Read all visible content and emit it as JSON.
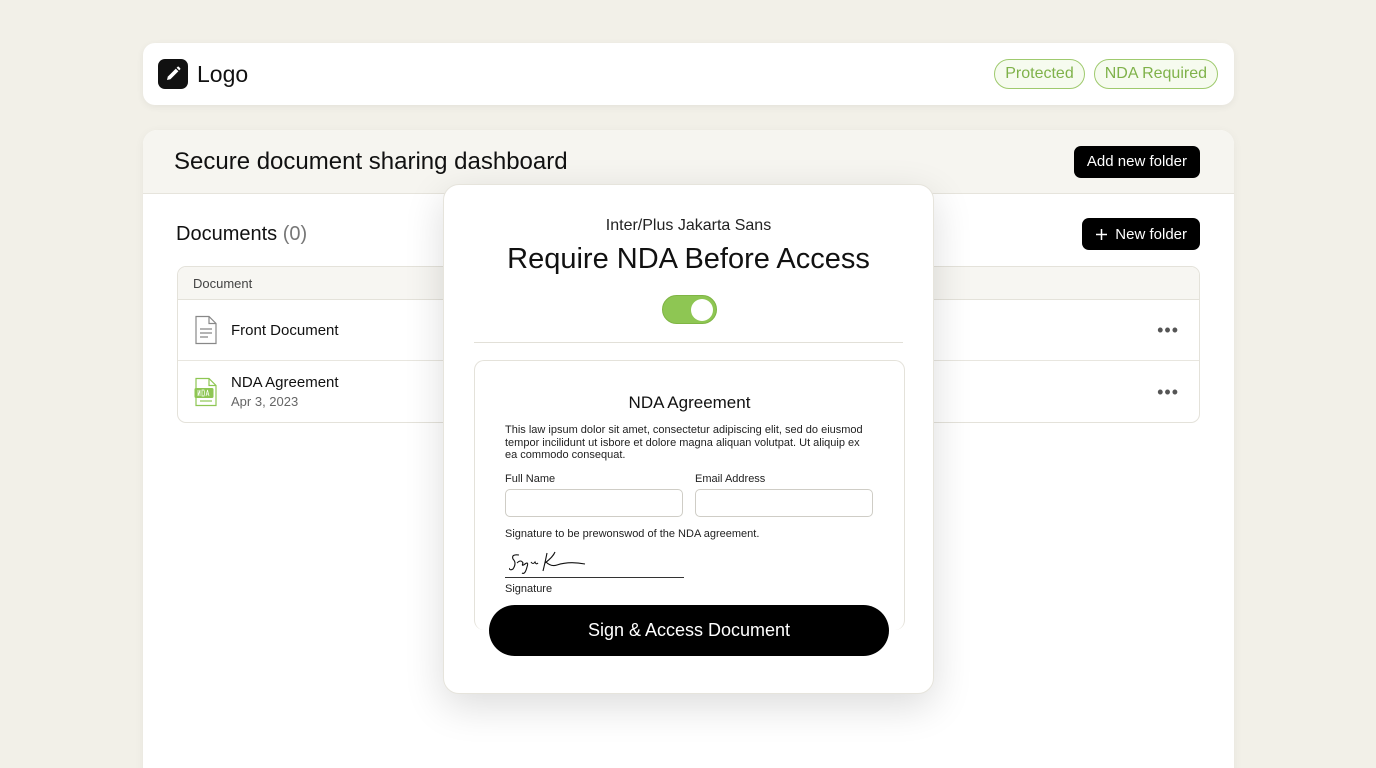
{
  "header": {
    "logo_text": "Logo",
    "tags": [
      "Protected",
      "NDA Required"
    ],
    "accent": "#8ec653"
  },
  "panel": {
    "title": "Secure document sharing dashboard",
    "add_folder_label": "Add new folder"
  },
  "documents": {
    "title": "Documents",
    "count": "(0)",
    "new_folder_label": "New folder",
    "column_header": "Document",
    "rows": [
      {
        "name": "Front Document",
        "date": "",
        "icon": "document-icon"
      },
      {
        "name": "NDA Agreement",
        "date": "Apr 3, 2023",
        "icon": "nda-file-icon"
      }
    ]
  },
  "modal": {
    "subtitle": "Inter/Plus Jakarta Sans",
    "title": "Require NDA Before Access",
    "toggle_on": true,
    "nda": {
      "title": "NDA Agreement",
      "body": "This law ipsum dolor sit amet, consectetur adipiscing elit, sed do eiusmod tempor incilidunt ut isbore et dolore magna aliquan volutpat. Ut aliquip ex ea commodo consequat.",
      "full_name_label": "Full Name",
      "email_label": "Email Address",
      "full_name_value": "",
      "email_value": "",
      "signature_note": "Signature to be prewonswod of the NDA agreement.",
      "signature_label": "Signature"
    },
    "sign_button_label": "Sign & Access Document"
  }
}
